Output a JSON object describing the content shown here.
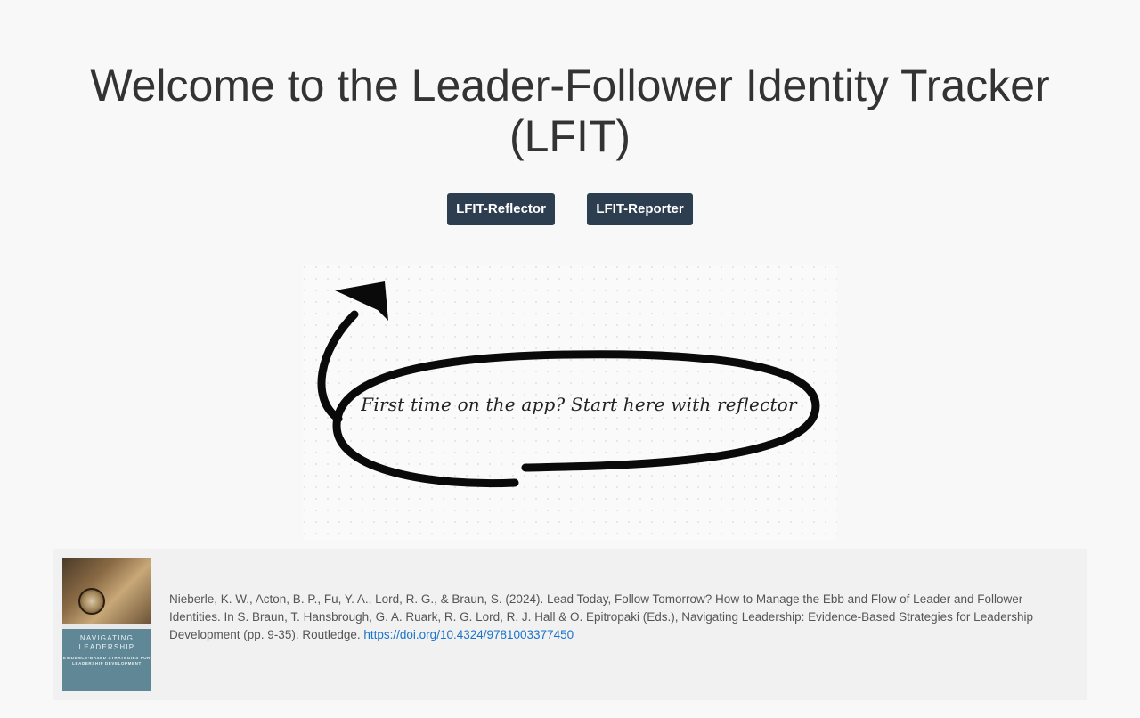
{
  "page": {
    "title": "Welcome to the Leader-Follower Identity Tracker (LFIT)"
  },
  "nav": {
    "reflector_label": "LFIT-Reflector",
    "reporter_label": "LFIT-Reporter"
  },
  "hero": {
    "message": "First time on the app? Start here with reflector"
  },
  "reference": {
    "book_title": "NAVIGATING LEADERSHIP",
    "book_subtitle": "EVIDENCE-BASED STRATEGIES FOR LEADERSHIP DEVELOPMENT",
    "citation": "Nieberle, K. W., Acton, B. P., Fu, Y. A., Lord, R. G., & Braun, S. (2024). Lead Today, Follow Tomorrow? How to Manage the Ebb and Flow of Leader and Follower Identities. In S. Braun, T. Hansbrough, G. A. Ruark, R. G. Lord, R. J. Hall & O. Epitropaki (Eds.), Navigating Leadership: Evidence-Based Strategies for Leadership Development (pp. 9-35). Routledge.",
    "doi_link": "https://doi.org/10.4324/9781003377450"
  },
  "colors": {
    "background": "#f8f8f8",
    "button": "#2c3e50",
    "link": "#1a73c8",
    "reference_box": "#f1f1f1"
  }
}
